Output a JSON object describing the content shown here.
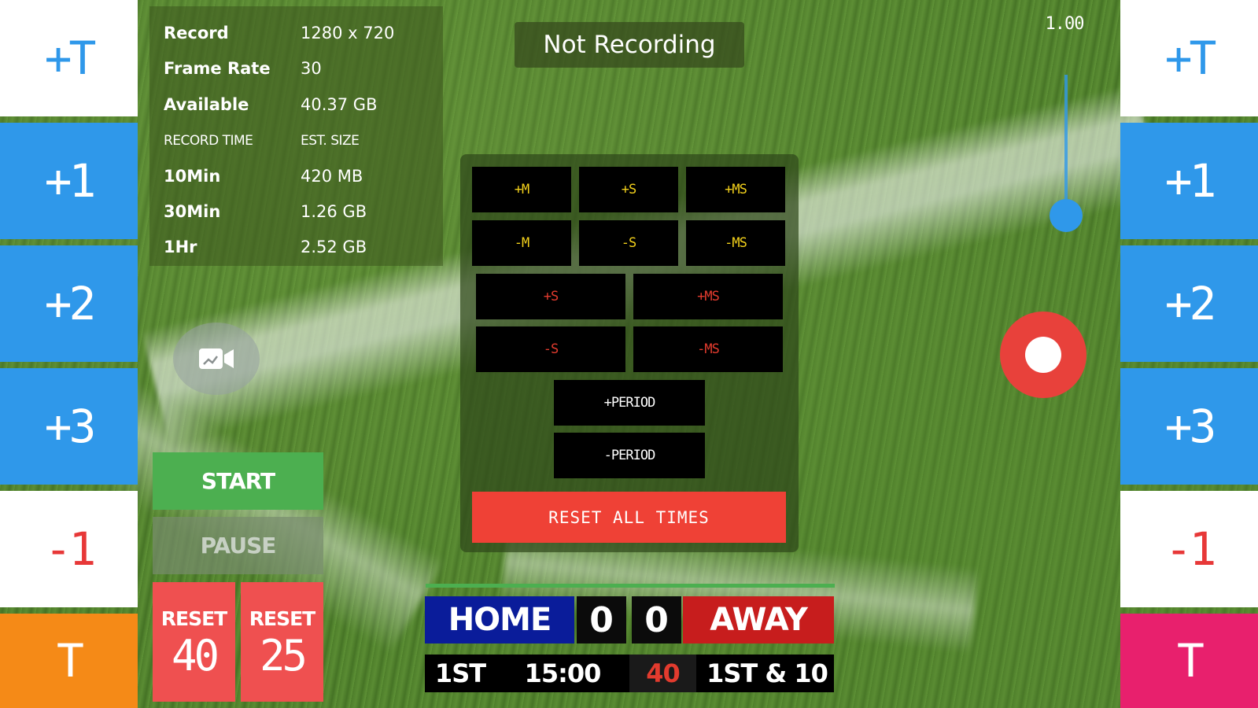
{
  "side_buttons": {
    "left": [
      {
        "label": "+T"
      },
      {
        "label": "+1"
      },
      {
        "label": "+2"
      },
      {
        "label": "+3"
      },
      {
        "label": "-1"
      },
      {
        "label": "T"
      }
    ],
    "right": [
      {
        "label": "+T"
      },
      {
        "label": "+1"
      },
      {
        "label": "+2"
      },
      {
        "label": "+3"
      },
      {
        "label": "-1"
      },
      {
        "label": "T"
      }
    ]
  },
  "info": {
    "rows": [
      {
        "key": "Record",
        "value": "1280 x 720"
      },
      {
        "key": "Frame Rate",
        "value": "30"
      },
      {
        "key": "Available",
        "value": "40.37 GB"
      },
      {
        "key": "RECORD TIME",
        "value": "EST. SIZE"
      },
      {
        "key": "10Min",
        "value": "420 MB"
      },
      {
        "key": "30Min",
        "value": "1.26 GB"
      },
      {
        "key": "1Hr",
        "value": "2.52 GB"
      }
    ]
  },
  "status": "Not Recording",
  "zoom": {
    "label": "1.00",
    "level": 1.0
  },
  "time_panel": {
    "row1": [
      "+M",
      "+S",
      "+MS"
    ],
    "row2": [
      "-M",
      "-S",
      "-MS"
    ],
    "row3": [
      "+S",
      "+MS"
    ],
    "row4": [
      "-S",
      "-MS"
    ],
    "period_plus": "+PERIOD",
    "period_minus": "-PERIOD",
    "reset_all": "RESET ALL TIMES"
  },
  "clock": {
    "start": "START",
    "pause": "PAUSE",
    "reset1": {
      "label": "RESET",
      "value": "40"
    },
    "reset2": {
      "label": "RESET",
      "value": "25"
    }
  },
  "scoreboard": {
    "home": "HOME",
    "away": "AWAY",
    "home_score": "0",
    "away_score": "0",
    "period": "1ST",
    "clock": "15:00",
    "play_clock": "40",
    "down": "1ST & 10"
  },
  "colors": {
    "accent_blue": "#2f98ea",
    "record_red": "#e8413b",
    "home_blue": "#0a1c9a",
    "away_red": "#c71d1d",
    "timeout_orange": "#f58a17",
    "timeout_pink": "#e8206d",
    "start_green": "#4caf50"
  }
}
